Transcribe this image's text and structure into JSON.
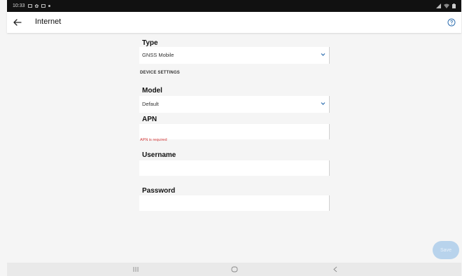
{
  "status_bar": {
    "time": "10:33"
  },
  "app_bar": {
    "title": "Internet",
    "back_icon": "arrow-left-icon",
    "help_icon": "help-circle-icon"
  },
  "form": {
    "type_label": "Type",
    "type_value": "GNSS Mobile",
    "section_device_settings": "DEVICE SETTINGS",
    "model_label": "Model",
    "model_value": "Default",
    "apn_label": "APN",
    "apn_value": "",
    "apn_error": "APN is required",
    "username_label": "Username",
    "username_value": "",
    "password_label": "Password",
    "password_value": ""
  },
  "actions": {
    "save_label": "Save"
  },
  "colors": {
    "error": "#d23c3c",
    "button_disabled": "#b8d3ec",
    "status_bar": "#111111"
  }
}
